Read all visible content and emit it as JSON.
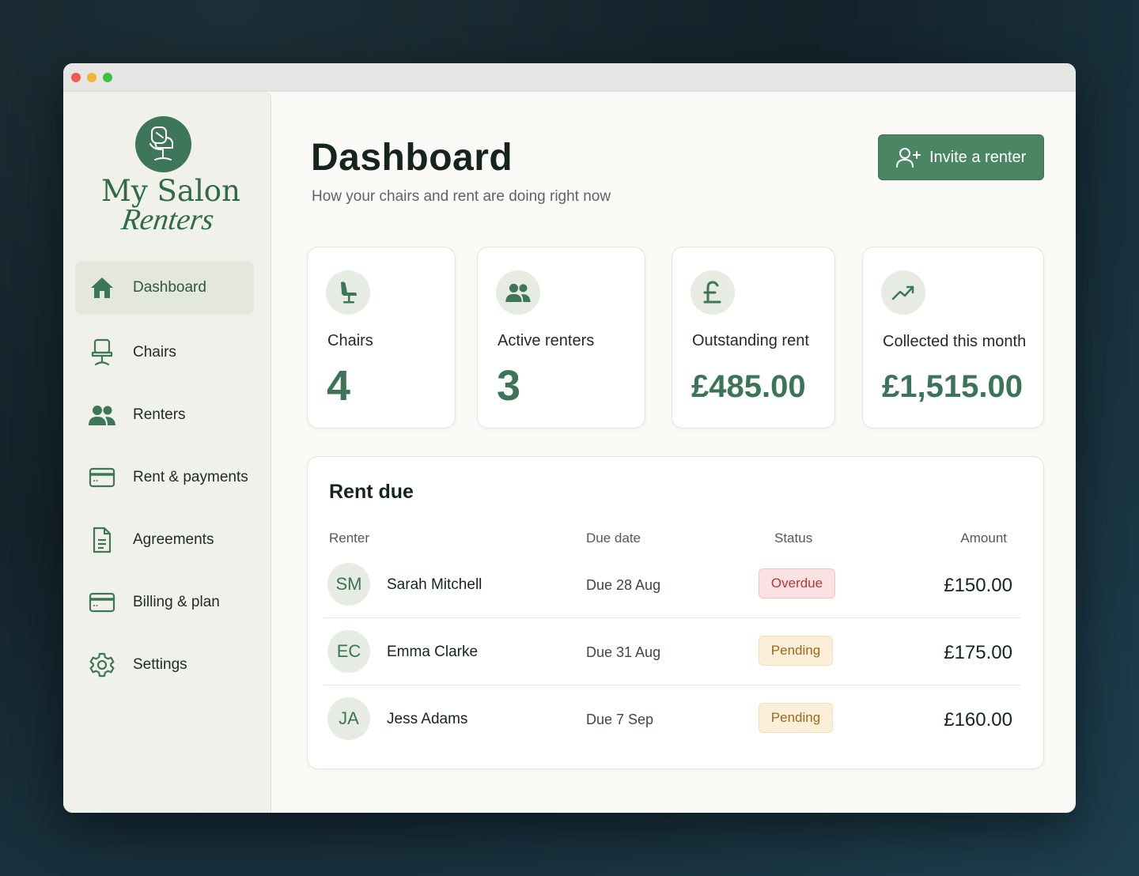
{
  "brand": {
    "name_line1": "My Salon",
    "name_line2": "Renters",
    "logo_icon": "salon-chair-icon",
    "color": "#3e7659"
  },
  "sidebar": {
    "items": [
      {
        "label": "Dashboard",
        "icon": "home-icon",
        "active": true
      },
      {
        "label": "Chairs",
        "icon": "chair-icon"
      },
      {
        "label": "Renters",
        "icon": "users-icon"
      },
      {
        "label": "Rent & payments",
        "icon": "credit-card-icon"
      },
      {
        "label": "Agreements",
        "icon": "document-icon"
      },
      {
        "label": "Billing & plan",
        "icon": "credit-card-icon"
      },
      {
        "label": "Settings",
        "icon": "gear-icon"
      }
    ]
  },
  "header": {
    "title": "Dashboard",
    "subtitle": "How your chairs and rent are doing right now",
    "invite_button": "Invite a renter",
    "invite_icon": "user-plus-icon"
  },
  "stats": [
    {
      "label": "Chairs",
      "value": "4",
      "icon": "chair-icon"
    },
    {
      "label": "Active renters",
      "value": "3",
      "icon": "users-icon"
    },
    {
      "label": "Outstanding rent",
      "value": "£485.00",
      "icon": "pound-icon"
    },
    {
      "label": "Collected this month",
      "value": "£1,515.00",
      "icon": "trending-up-icon"
    }
  ],
  "rent_due": {
    "title": "Rent due",
    "columns": {
      "renter": "Renter",
      "due_date": "Due date",
      "status": "Status",
      "amount": "Amount"
    },
    "rows": [
      {
        "initials": "SM",
        "name": "Sarah Mitchell",
        "due": "Due 28 Aug",
        "status": "Overdue",
        "amount": "£150.00"
      },
      {
        "initials": "EC",
        "name": "Emma Clarke",
        "due": "Due 31 Aug",
        "status": "Pending",
        "amount": "£175.00"
      },
      {
        "initials": "JA",
        "name": "Jess Adams",
        "due": "Due 7 Sep",
        "status": "Pending",
        "amount": "£160.00"
      }
    ]
  },
  "colors": {
    "accent": "#4a8564",
    "overdue_bg": "#fbe2e2",
    "overdue_text": "#b43636",
    "pending_bg": "#fcefd9",
    "pending_text": "#9a6a1c"
  }
}
